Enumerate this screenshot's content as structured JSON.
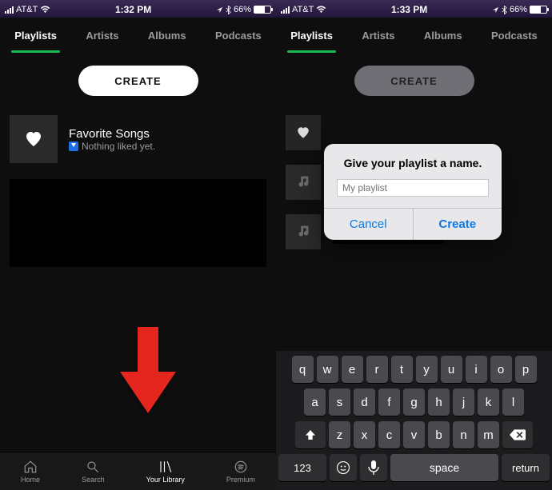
{
  "left": {
    "status": {
      "carrier": "AT&T",
      "time": "1:32 PM",
      "battery_pct": "66%",
      "battery_fill": 66
    },
    "tabs": [
      "Playlists",
      "Artists",
      "Albums",
      "Podcasts"
    ],
    "active_tab_index": 0,
    "create_label": "CREATE",
    "favorite_row": {
      "title": "Favorite Songs",
      "subtitle": "Nothing liked yet."
    },
    "bottom_nav": [
      {
        "label": "Home"
      },
      {
        "label": "Search"
      },
      {
        "label": "Your Library"
      },
      {
        "label": "Premium"
      }
    ],
    "active_nav_index": 2
  },
  "right": {
    "status": {
      "carrier": "AT&T",
      "time": "1:33 PM",
      "battery_pct": "66%",
      "battery_fill": 66
    },
    "tabs": [
      "Playlists",
      "Artists",
      "Albums",
      "Podcasts"
    ],
    "active_tab_index": 0,
    "create_label": "CREATE",
    "dialog": {
      "title": "Give your playlist a name.",
      "placeholder": "My playlist",
      "cancel": "Cancel",
      "create": "Create"
    },
    "keyboard": {
      "row1": [
        "q",
        "w",
        "e",
        "r",
        "t",
        "y",
        "u",
        "i",
        "o",
        "p"
      ],
      "row2": [
        "a",
        "s",
        "d",
        "f",
        "g",
        "h",
        "j",
        "k",
        "l"
      ],
      "row3": [
        "z",
        "x",
        "c",
        "v",
        "b",
        "n",
        "m"
      ],
      "num_key": "123",
      "space": "space",
      "return": "return"
    }
  }
}
